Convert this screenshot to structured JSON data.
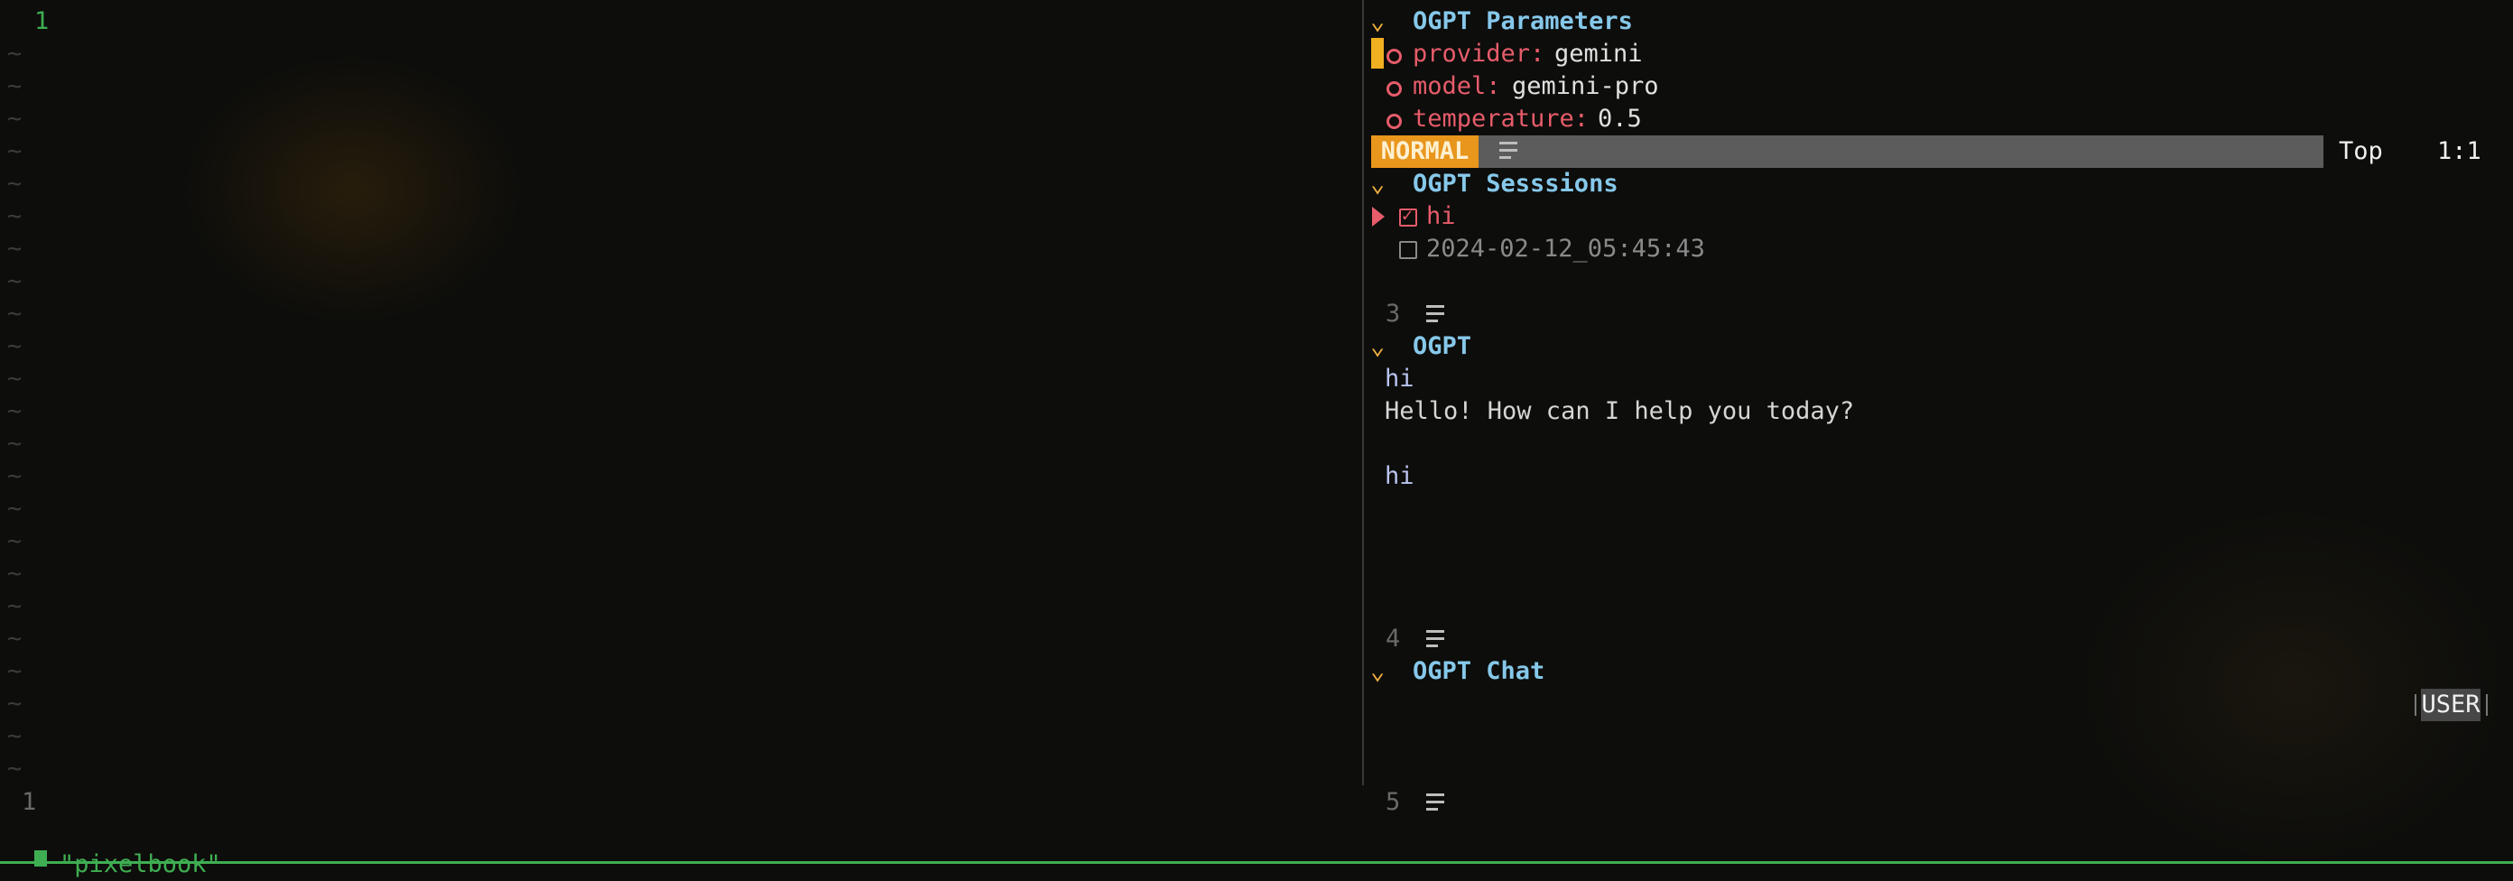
{
  "left_pane": {
    "line_number": "1",
    "tilde": "~",
    "bottom_line_number": "1"
  },
  "params": {
    "title": "OGPT Parameters",
    "items": [
      {
        "key": "provider:",
        "value": "gemini"
      },
      {
        "key": "model:",
        "value": "gemini-pro"
      },
      {
        "key": "temperature:",
        "value": "0.5"
      }
    ]
  },
  "statusline": {
    "mode": "NORMAL",
    "position": "Top",
    "cursor": "1:1"
  },
  "sessions": {
    "title": "OGPT Sesssions",
    "items": [
      {
        "label": "hi",
        "checked": true
      },
      {
        "label": "2024-02-12_05:45:43",
        "checked": false
      }
    ]
  },
  "winbar3": {
    "number": "3"
  },
  "ogpt": {
    "title": "OGPT",
    "lines": [
      "hi",
      "Hello! How can I help you today?",
      "hi"
    ]
  },
  "winbar4": {
    "number": "4"
  },
  "chat": {
    "title": "OGPT Chat",
    "role": "USER"
  },
  "winbar5": {
    "number": "5"
  },
  "cmdline": {
    "text": "\"pixelbook\""
  },
  "colors": {
    "mode_bg": "#e8961c",
    "header": "#86c8ea",
    "key": "#e65c6a",
    "line_number": "#3fae52"
  }
}
